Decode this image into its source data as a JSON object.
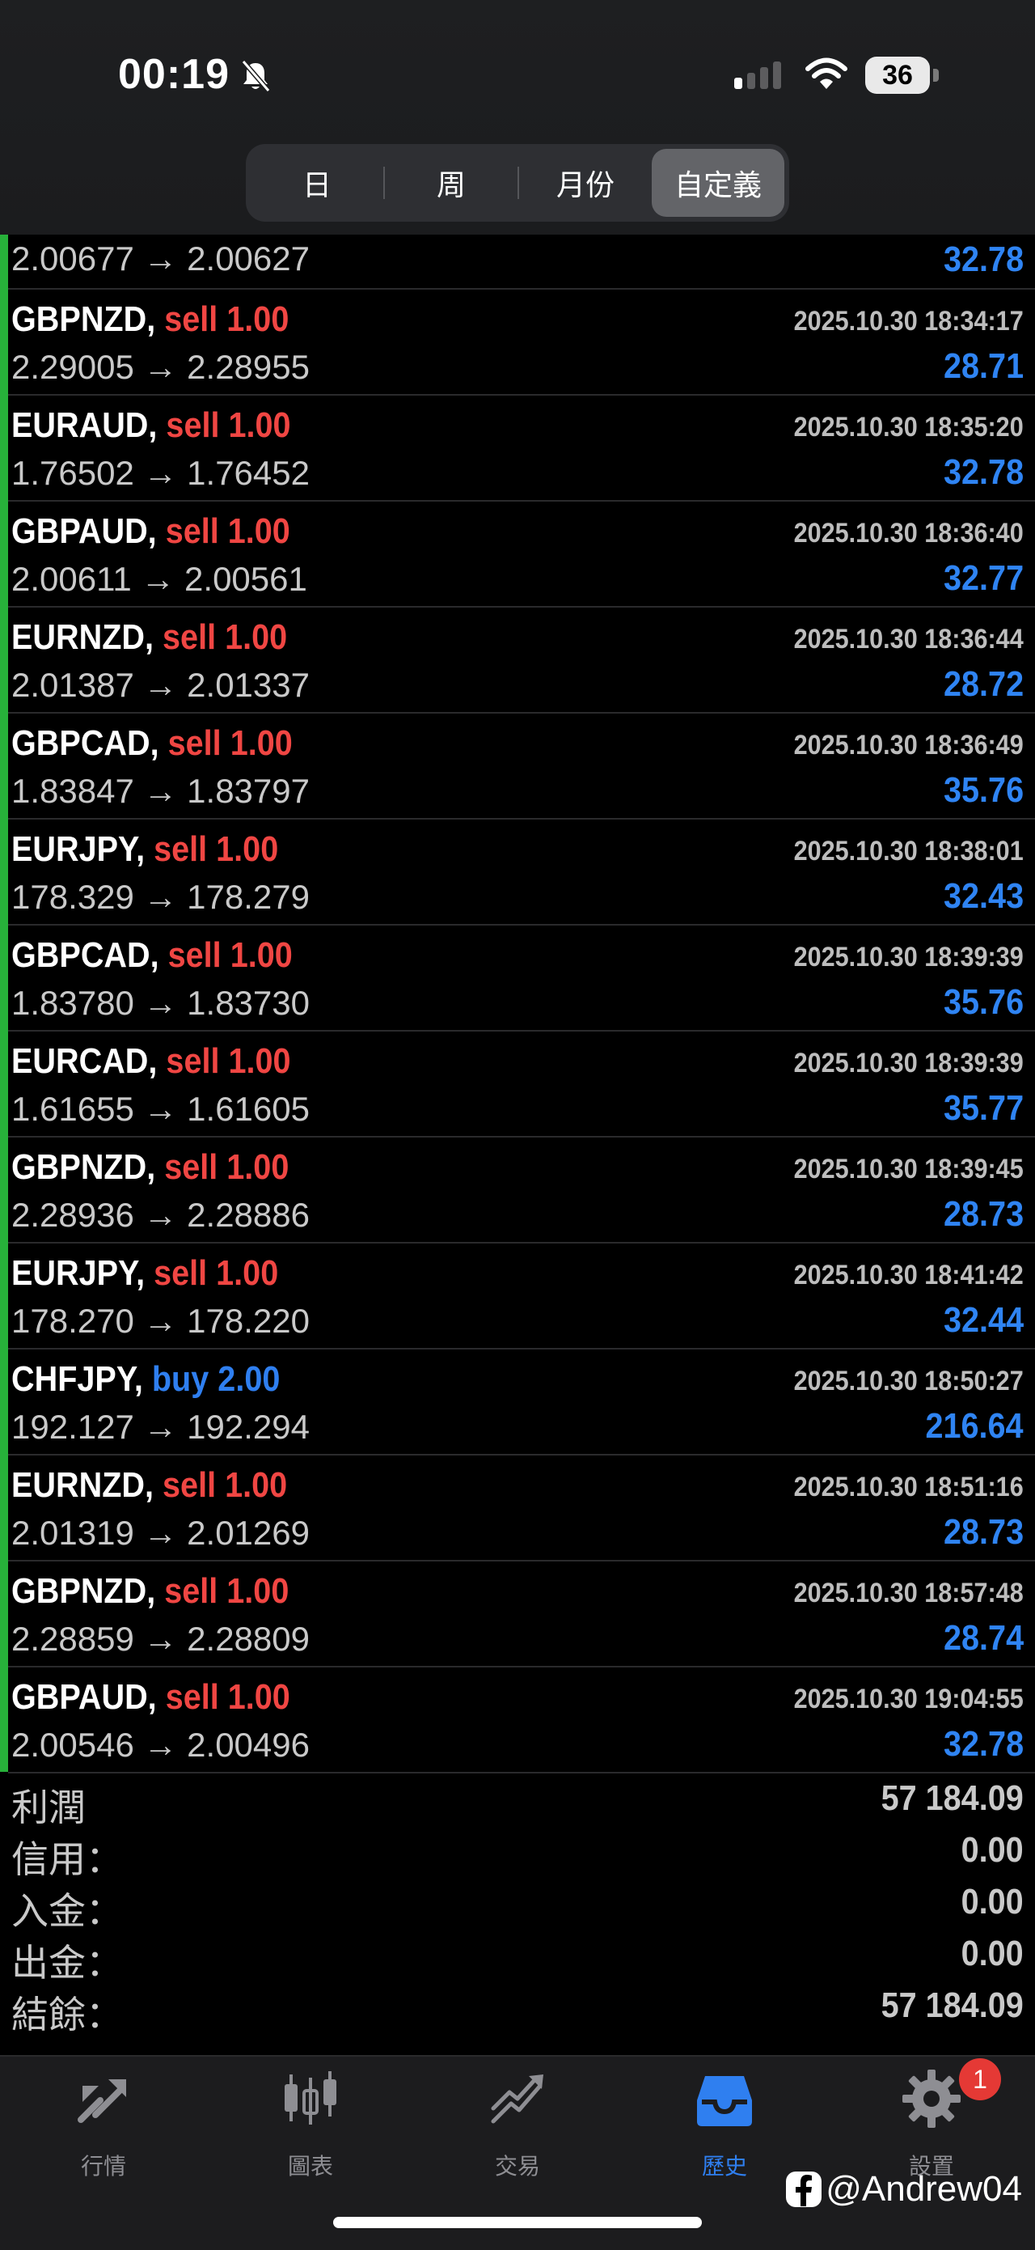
{
  "status_bar": {
    "time": "00:19",
    "battery": "36"
  },
  "segments": [
    {
      "label": "日",
      "active": false
    },
    {
      "label": "周",
      "active": false
    },
    {
      "label": "月份",
      "active": false
    },
    {
      "label": "自定義",
      "active": true
    }
  ],
  "trades": [
    {
      "symbol": "",
      "side": "",
      "volume": "",
      "date": "",
      "open": "2.00677",
      "close": "2.00627",
      "profit": "32.78"
    },
    {
      "symbol": "GBPNZD,",
      "side": "sell",
      "volume": "1.00",
      "date": "2025.10.30 18:34:17",
      "open": "2.29005",
      "close": "2.28955",
      "profit": "28.71"
    },
    {
      "symbol": "EURAUD,",
      "side": "sell",
      "volume": "1.00",
      "date": "2025.10.30 18:35:20",
      "open": "1.76502",
      "close": "1.76452",
      "profit": "32.78"
    },
    {
      "symbol": "GBPAUD,",
      "side": "sell",
      "volume": "1.00",
      "date": "2025.10.30 18:36:40",
      "open": "2.00611",
      "close": "2.00561",
      "profit": "32.77"
    },
    {
      "symbol": "EURNZD,",
      "side": "sell",
      "volume": "1.00",
      "date": "2025.10.30 18:36:44",
      "open": "2.01387",
      "close": "2.01337",
      "profit": "28.72"
    },
    {
      "symbol": "GBPCAD,",
      "side": "sell",
      "volume": "1.00",
      "date": "2025.10.30 18:36:49",
      "open": "1.83847",
      "close": "1.83797",
      "profit": "35.76"
    },
    {
      "symbol": "EURJPY,",
      "side": "sell",
      "volume": "1.00",
      "date": "2025.10.30 18:38:01",
      "open": "178.329",
      "close": "178.279",
      "profit": "32.43"
    },
    {
      "symbol": "GBPCAD,",
      "side": "sell",
      "volume": "1.00",
      "date": "2025.10.30 18:39:39",
      "open": "1.83780",
      "close": "1.83730",
      "profit": "35.76"
    },
    {
      "symbol": "EURCAD,",
      "side": "sell",
      "volume": "1.00",
      "date": "2025.10.30 18:39:39",
      "open": "1.61655",
      "close": "1.61605",
      "profit": "35.77"
    },
    {
      "symbol": "GBPNZD,",
      "side": "sell",
      "volume": "1.00",
      "date": "2025.10.30 18:39:45",
      "open": "2.28936",
      "close": "2.28886",
      "profit": "28.73"
    },
    {
      "symbol": "EURJPY,",
      "side": "sell",
      "volume": "1.00",
      "date": "2025.10.30 18:41:42",
      "open": "178.270",
      "close": "178.220",
      "profit": "32.44"
    },
    {
      "symbol": "CHFJPY,",
      "side": "buy",
      "volume": "2.00",
      "date": "2025.10.30 18:50:27",
      "open": "192.127",
      "close": "192.294",
      "profit": "216.64"
    },
    {
      "symbol": "EURNZD,",
      "side": "sell",
      "volume": "1.00",
      "date": "2025.10.30 18:51:16",
      "open": "2.01319",
      "close": "2.01269",
      "profit": "28.73"
    },
    {
      "symbol": "GBPNZD,",
      "side": "sell",
      "volume": "1.00",
      "date": "2025.10.30 18:57:48",
      "open": "2.28859",
      "close": "2.28809",
      "profit": "28.74"
    },
    {
      "symbol": "GBPAUD,",
      "side": "sell",
      "volume": "1.00",
      "date": "2025.10.30 19:04:55",
      "open": "2.00546",
      "close": "2.00496",
      "profit": "32.78"
    }
  ],
  "arrow": "→",
  "summary": [
    {
      "label": "利潤",
      "value": "57 184.09"
    },
    {
      "label": "信用：",
      "value": "0.00"
    },
    {
      "label": "入金：",
      "value": "0.00"
    },
    {
      "label": "出金：",
      "value": "0.00"
    },
    {
      "label": "結餘：",
      "value": "57 184.09"
    }
  ],
  "tabs": [
    {
      "label": "行情",
      "icon": "quotes-icon",
      "active": false
    },
    {
      "label": "圖表",
      "icon": "chart-icon",
      "active": false
    },
    {
      "label": "交易",
      "icon": "trade-icon",
      "active": false
    },
    {
      "label": "歷史",
      "icon": "history-icon",
      "active": true
    },
    {
      "label": "設置",
      "icon": "settings-icon",
      "active": false,
      "badge": "1"
    }
  ],
  "watermark": "@Andrew04",
  "colors": {
    "sell": "#f04643",
    "buy": "#2f7ff0",
    "profit": "#2f84f3",
    "accent": "#27b13a"
  }
}
